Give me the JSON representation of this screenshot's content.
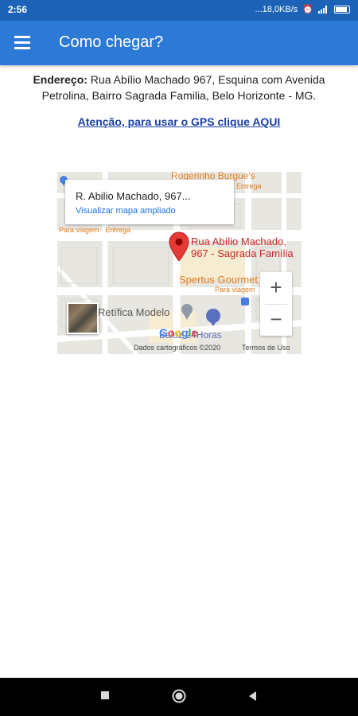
{
  "status_bar": {
    "time": "2:56",
    "speed": "...18,0KB/s"
  },
  "app_bar": {
    "title": "Como chegar?",
    "menu_icon": "menu-icon"
  },
  "address": {
    "label": "Endereço:",
    "line1": " Rua Abílio Machado 967, Esquina com Avenida",
    "line2": "Petrolina, Bairro Sagrada Familia, Belo Horizonte - MG."
  },
  "gps_link": "Atenção, para usar o GPS clique AQUI",
  "map": {
    "info_title": "R. Abilio Machado, 967...",
    "info_link": "Visualizar mapa ampliado",
    "place_line1": "Rua Abílio Machado,",
    "place_line2": "967 - Sagrada Família",
    "labels": {
      "rogerinho": "Rogerinho Burgue's",
      "rogerinho_sub": "Entrega",
      "viagem_left": "Para viagem · Entrega",
      "spertus": "Spertus Gourmet",
      "spertus_sub": "Para viagem",
      "retifica": "Retífica Modelo",
      "baluz": "Baluz 24Horas",
      "google": "Google",
      "copyright": "Dados cartográficos ©2020",
      "terms": "Termos de Uso"
    },
    "zoom_in": "+",
    "zoom_out": "−"
  },
  "colors": {
    "app_bar": "#2d7ad6",
    "status_bar": "#1c63b7",
    "link": "#1a3fa8",
    "pin": "#e53935"
  }
}
